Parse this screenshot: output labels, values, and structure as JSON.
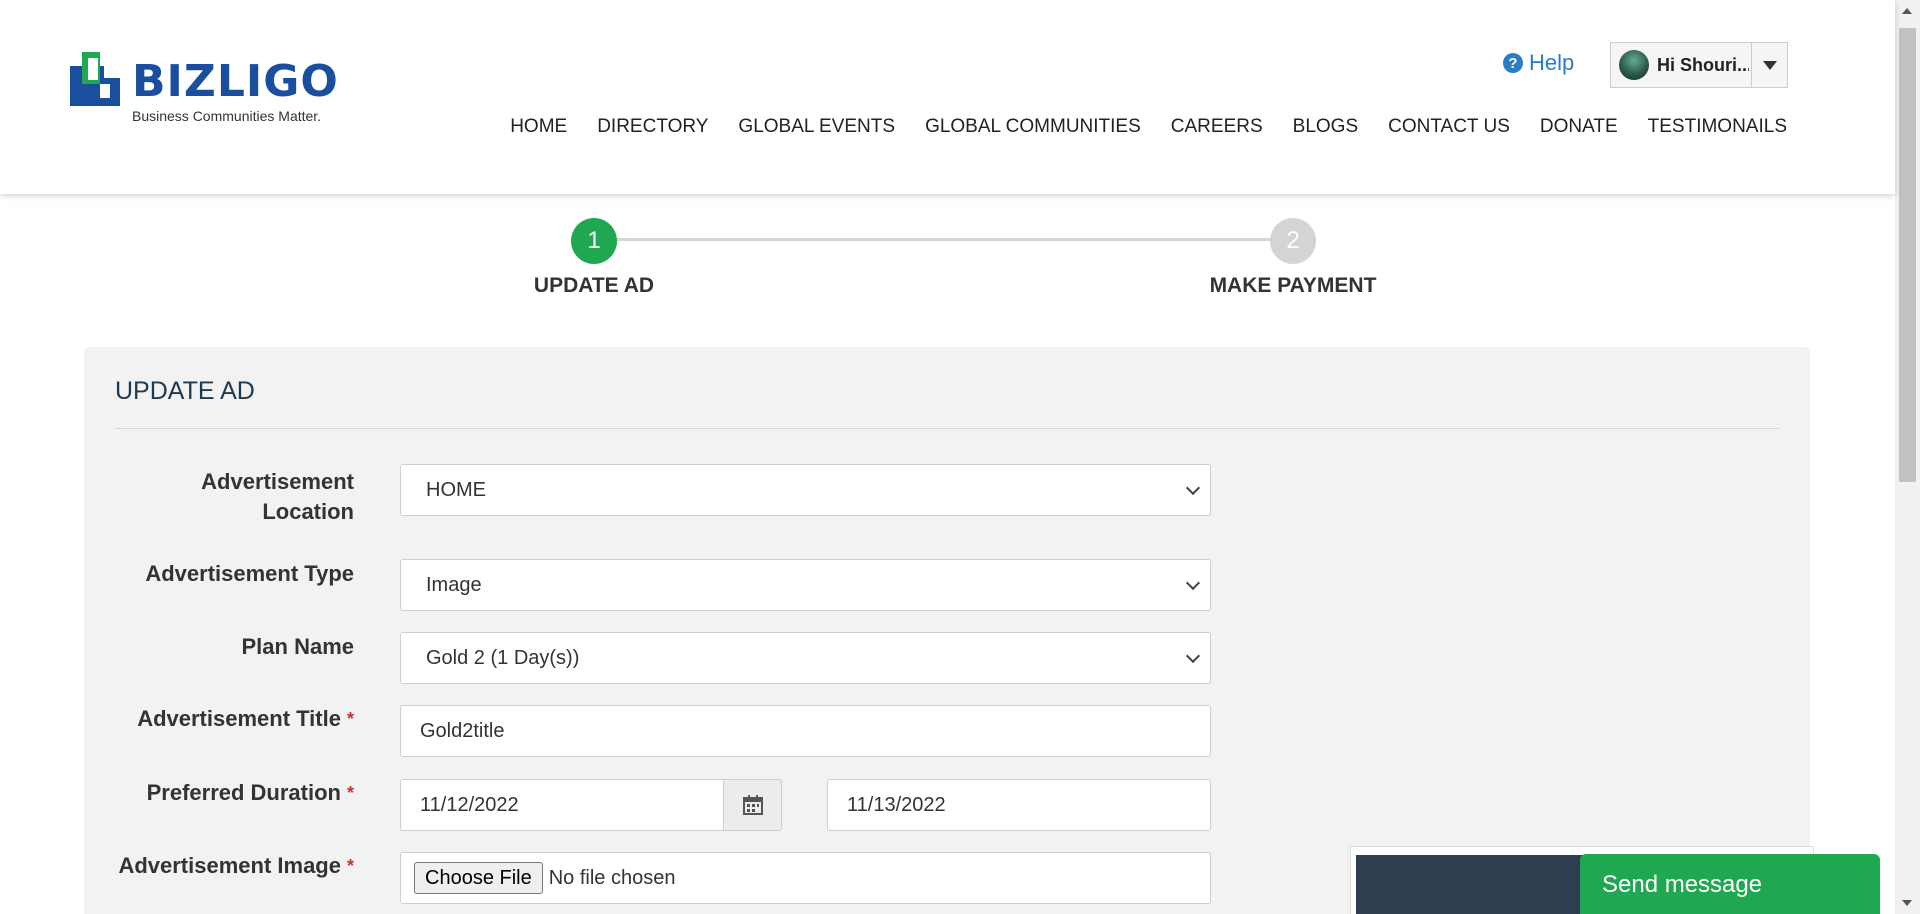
{
  "brand": {
    "name": "BIZLIGO",
    "tagline": "Business Communities Matter.",
    "color": "#1a4fa0",
    "accent": "#1fa851"
  },
  "header": {
    "help_label": "Help",
    "help_icon": "question-circle-icon",
    "user_name": "Hi Shouri...",
    "nav": [
      "HOME",
      "DIRECTORY",
      "GLOBAL EVENTS",
      "GLOBAL COMMUNITIES",
      "CAREERS",
      "BLOGS",
      "CONTACT US",
      "DONATE",
      "TESTIMONAILS"
    ]
  },
  "stepper": {
    "steps": [
      {
        "number": "1",
        "label": "UPDATE AD",
        "state": "active",
        "color": "#1fa851"
      },
      {
        "number": "2",
        "label": "MAKE PAYMENT",
        "state": "inactive",
        "color": "#d4d4d4"
      }
    ]
  },
  "form": {
    "title": "UPDATE AD",
    "required_mark": "*",
    "location": {
      "label_line1": "Advertisement",
      "label_line2": "Location",
      "value": "HOME"
    },
    "type": {
      "label": "Advertisement Type",
      "value": "Image"
    },
    "plan": {
      "label": "Plan Name",
      "value": "Gold 2 (1 Day(s))"
    },
    "title_field": {
      "label": "Advertisement Title",
      "value": "Gold2title"
    },
    "duration": {
      "label": "Preferred Duration",
      "start": "11/12/2022",
      "end": "11/13/2022",
      "icon": "calendar-icon"
    },
    "image": {
      "label": "Advertisement Image",
      "button": "Choose File",
      "status": "No file chosen"
    }
  },
  "chat": {
    "label": "Send message"
  }
}
